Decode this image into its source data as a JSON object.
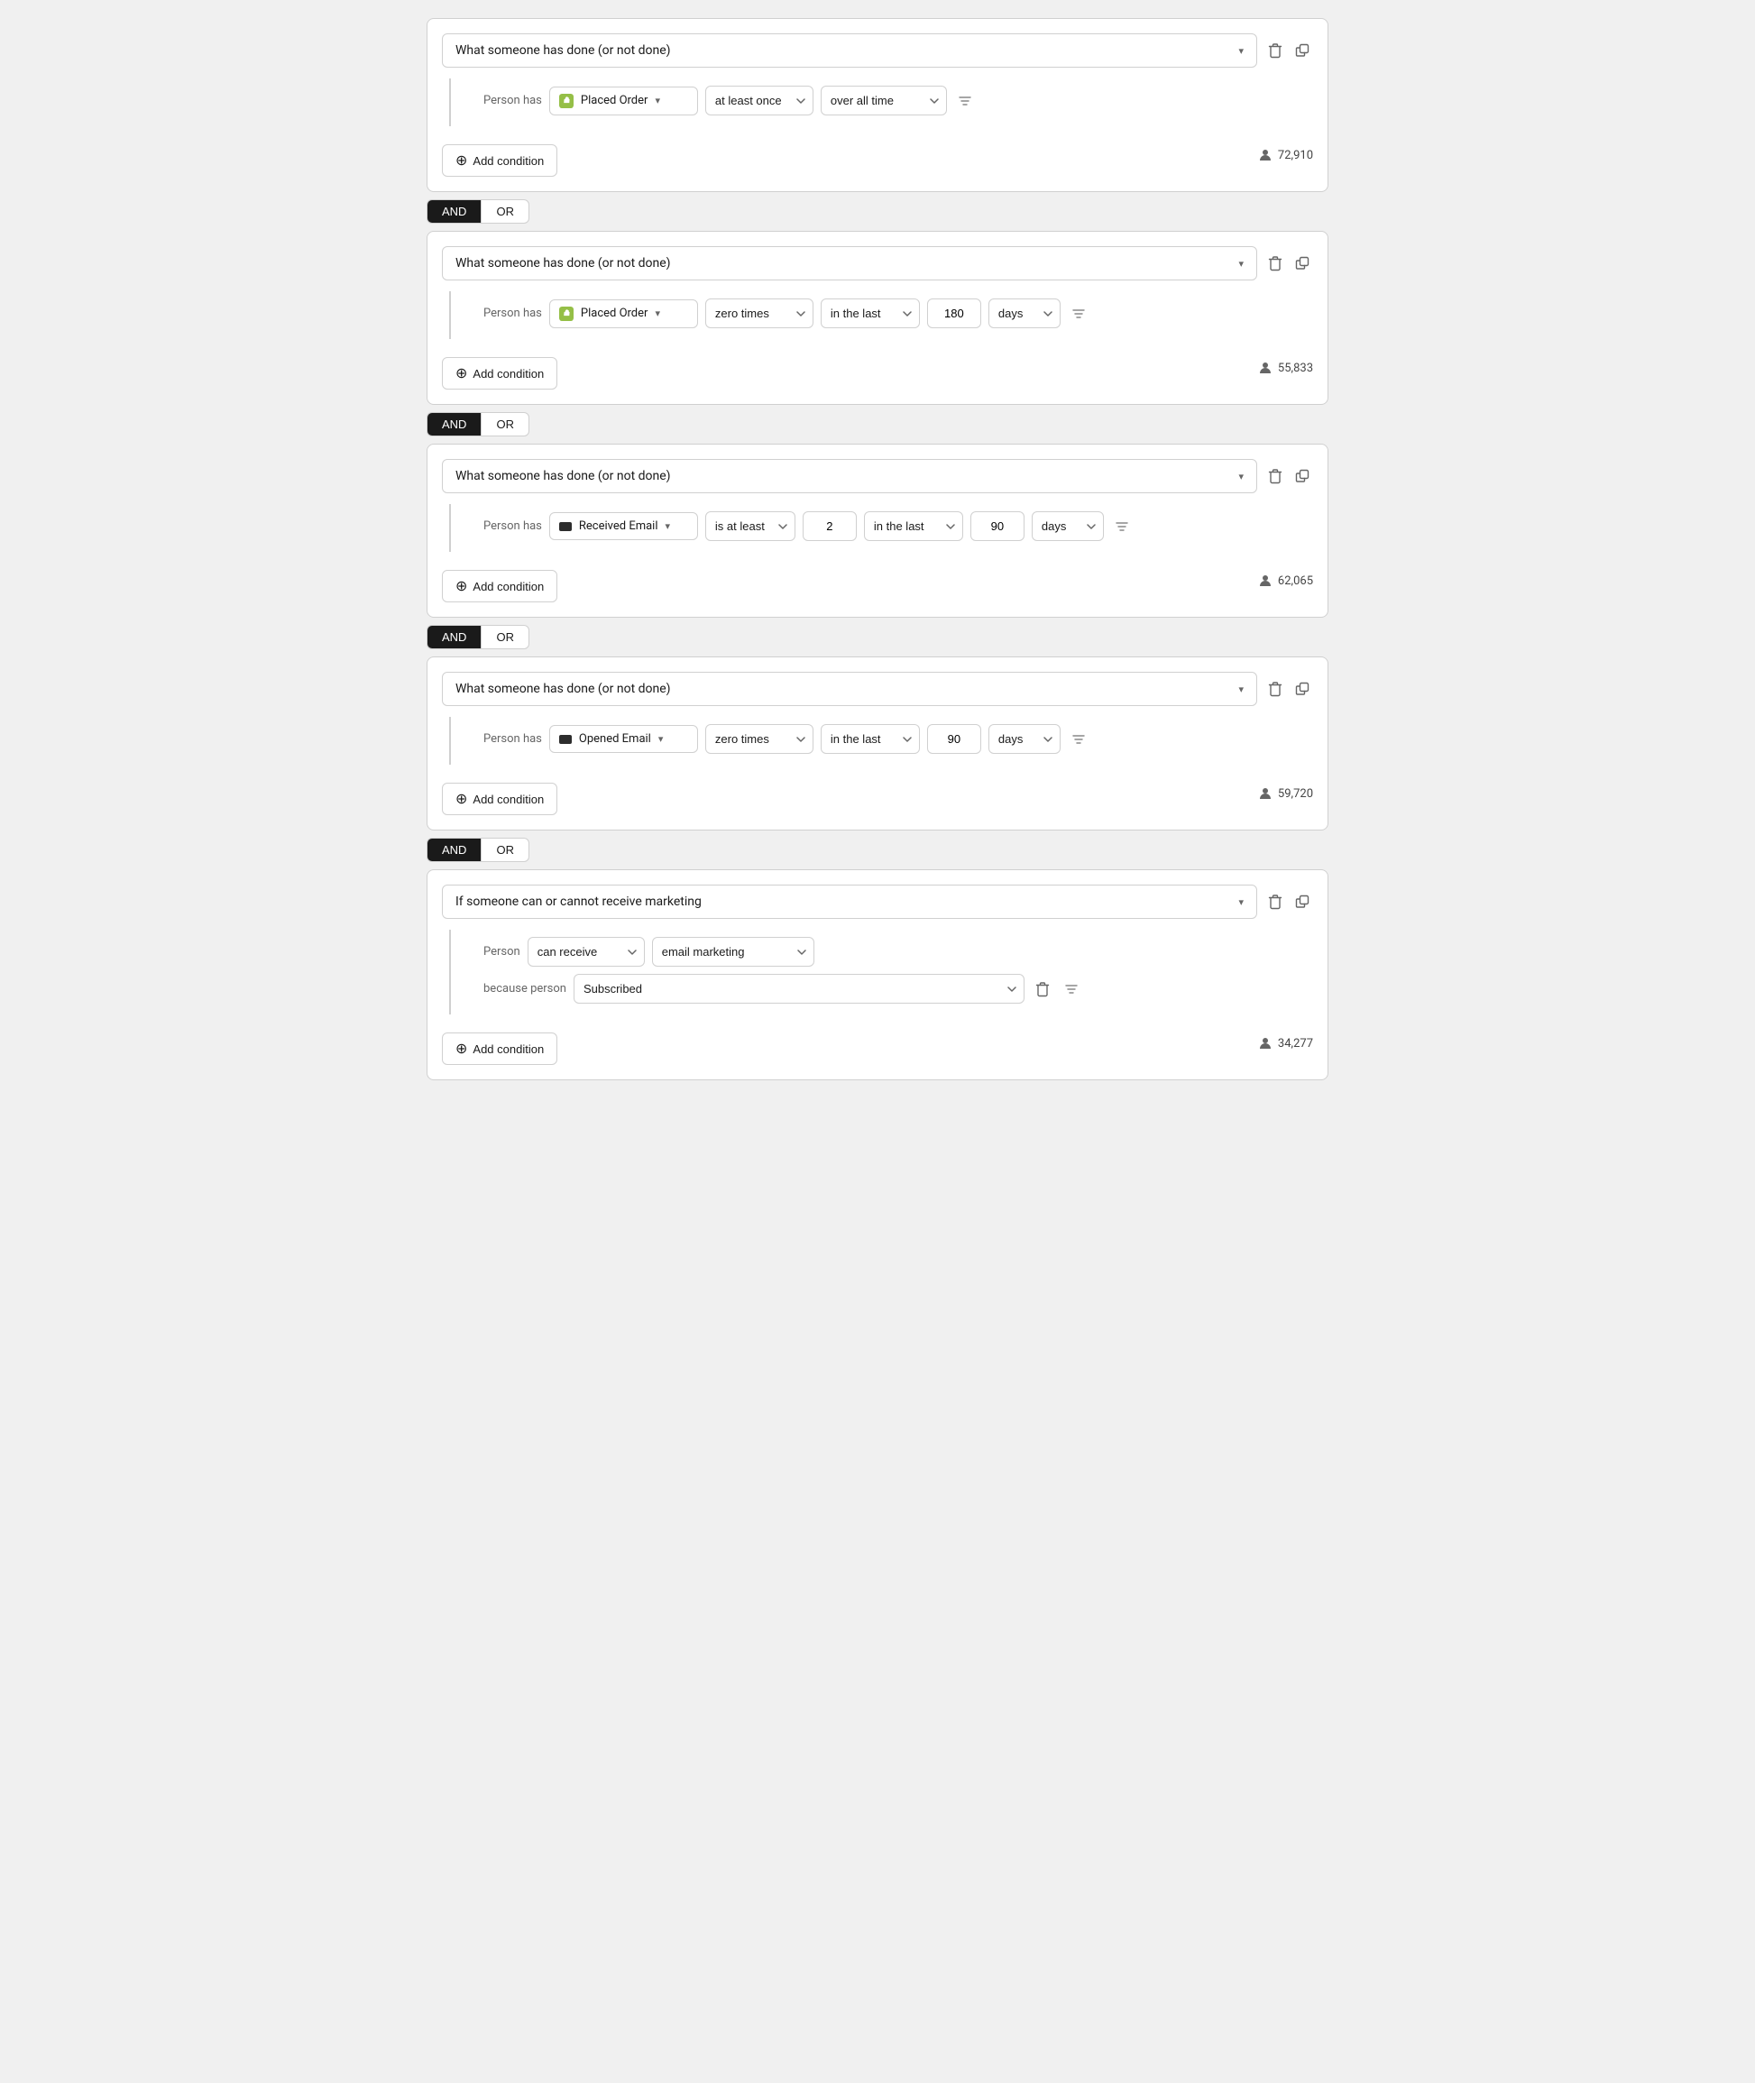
{
  "blocks": [
    {
      "id": "block1",
      "type": "action",
      "mainLabel": "What someone has done (or not done)",
      "personHas": "Person has",
      "actionType": "Placed Order",
      "actionIcon": "shopify",
      "frequency": "at least once",
      "hasTimeframe": false,
      "timeframe": "over all time",
      "count": "72,910"
    },
    {
      "id": "block2",
      "type": "action",
      "mainLabel": "What someone has done (or not done)",
      "personHas": "Person has",
      "actionType": "Placed Order",
      "actionIcon": "shopify",
      "frequency": "zero times",
      "hasTimeframe": true,
      "timeframeLabel": "in the last",
      "timeframeValue": "180",
      "timeframeUnit": "days",
      "count": "55,833"
    },
    {
      "id": "block3",
      "type": "action",
      "mainLabel": "What someone has done (or not done)",
      "personHas": "Person has",
      "actionType": "Received Email",
      "actionIcon": "email",
      "frequency": "is at least",
      "hasCount": true,
      "countValue": "2",
      "hasTimeframe": true,
      "timeframeLabel": "in the last",
      "timeframeValue": "90",
      "timeframeUnit": "days",
      "count": "62,065"
    },
    {
      "id": "block4",
      "type": "action",
      "mainLabel": "What someone has done (or not done)",
      "personHas": "Person has",
      "actionType": "Opened Email",
      "actionIcon": "email",
      "frequency": "zero times",
      "hasTimeframe": true,
      "timeframeLabel": "in the last",
      "timeframeValue": "90",
      "timeframeUnit": "days",
      "count": "59,720"
    },
    {
      "id": "block5",
      "type": "marketing",
      "mainLabel": "If someone can or cannot receive marketing",
      "personLabel": "Person",
      "canReceive": "can receive",
      "marketingType": "email marketing",
      "becausePersonLabel": "because person",
      "subscriptionStatus": "Subscribed",
      "count": "34,277"
    }
  ],
  "andOrGroups": [
    {
      "id": "ao1"
    },
    {
      "id": "ao2"
    },
    {
      "id": "ao3"
    },
    {
      "id": "ao4"
    }
  ],
  "labels": {
    "addCondition": "Add condition",
    "and": "AND",
    "or": "OR",
    "personHas": "Person has",
    "overAllTime": "over all time",
    "inTheLast": "in the last",
    "days": "days",
    "zeroTimes": "zero times",
    "atLeastOnce": "at least once",
    "isAtLeast": "is at least"
  },
  "icons": {
    "chevronDown": "▾",
    "trash": "🗑",
    "copy": "⧉",
    "filter": "⊘",
    "plus": "+",
    "person": "👤"
  }
}
